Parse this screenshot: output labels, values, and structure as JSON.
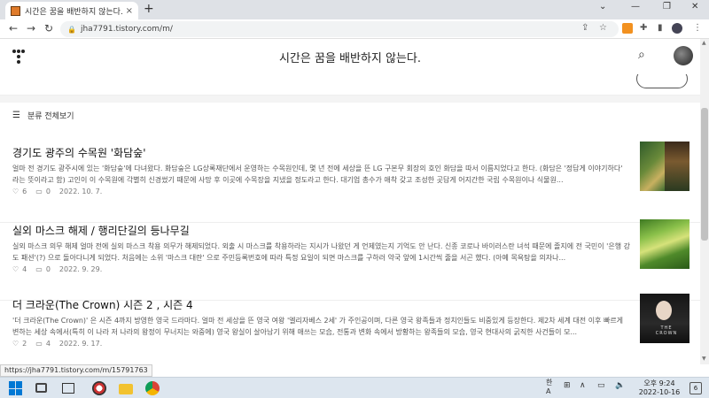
{
  "browser": {
    "tab_title": "시간은 꿈을 배반하지 않는다.",
    "tab_close": "×",
    "new_tab": "+",
    "url": "jha7791.tistory.com/m/",
    "win_controls": [
      "⌄",
      "—",
      "❐",
      "✕"
    ],
    "status_url": "https://jha7791.tistory.com/m/15791763"
  },
  "blog": {
    "title": "시간은 꿈을 배반하지 않는다.",
    "category_label": "분류 전체보기"
  },
  "posts": [
    {
      "title": "경기도 광주의 수목원 '화담숲'",
      "excerpt": "얼마 전 경기도 광주시에 있는 '화담숲'에 다녀왔다. 화담숲은 LG상록재단에서 운영하는 수목원인데, 몇 년 전에 세상을 뜬 LG 구본무 회장의 호인 화담을 따서 이름지었다고 한다. (화담은 '정답게 이야기하다' 라는 뜻이라고 함) 고인이 이 수목원에 각별히 신경썼기 때문에 사망 후 이곳에 수목장을 지냈을 정도라고 한다. 대기업 총수가 애착 갖고 조성한 곳답게 어지간한 국립 수목원이나 식물원...",
      "likes": "6",
      "comments": "0",
      "date": "2022. 10. 7."
    },
    {
      "title": "실외 마스크 해제 / 행리단길의 등나무길",
      "excerpt": "실외 마스크 의무 해제 얼마 전에 실외 마스크 착용 의무가 해제되었다. 외출 시 마스크를 착용하라는 지시가 나왔던 게 언제였는지 기억도 안 난다. 신종 코로나 바이러스란 녀석 때문에 졸지에 전 국민이 '은행 강도 패션'(?) 으로 돌아다니게 되었다. 처음에는 소위 '마스크 대란' 으로 주민등록번호에 따라 특정 요일이 되면 마스크를 구하러 약국 앞에 1시간씩 줄을 서곤 했다. (아예 목욕탕을 의자나...",
      "likes": "4",
      "comments": "0",
      "date": "2022. 9. 29."
    },
    {
      "title": "더 크라운(The Crown) 시즌 2 , 시즌 4",
      "excerpt": "'더 크라운(The Crown)' 은 시즌 4까지 방영한 영국 드라마다. 얼마 전 세상을 뜬 영국 여왕 '엘리자베스 2세' 가 주인공이며, 다른 영국 왕족들과 정치인들도 비중있게 등장한다. 제2차 세계 대전 이후 빠르게 변하는 세상 속에서(특히 이 나라 저 나라의 왕정이 무너지는 와중에) 영국 왕실이 살아남기 위해 애쓰는 모습, 전통과 변화 속에서 방황하는 왕족들의 모습, 영국 현대사의 굵직한 사건들이 모...",
      "likes": "2",
      "comments": "4",
      "date": "2022. 9. 17.",
      "thumb_text": "THE CROWN"
    }
  ],
  "taskbar": {
    "ime_top": "한",
    "ime_bottom": "A",
    "time": "오후 9:24",
    "date": "2022-10-16",
    "notification_count": "6"
  }
}
